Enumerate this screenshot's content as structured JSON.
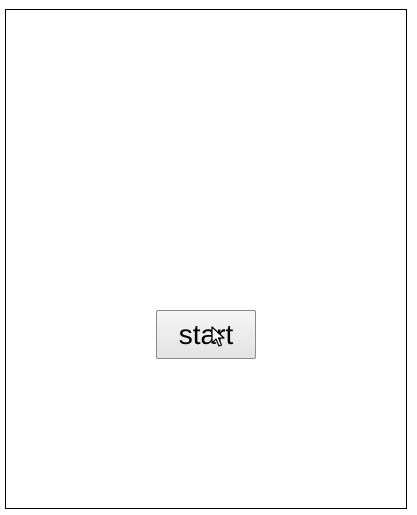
{
  "start_button": {
    "label": "start"
  },
  "cursor": {
    "icon": "arrow-cursor-icon"
  }
}
